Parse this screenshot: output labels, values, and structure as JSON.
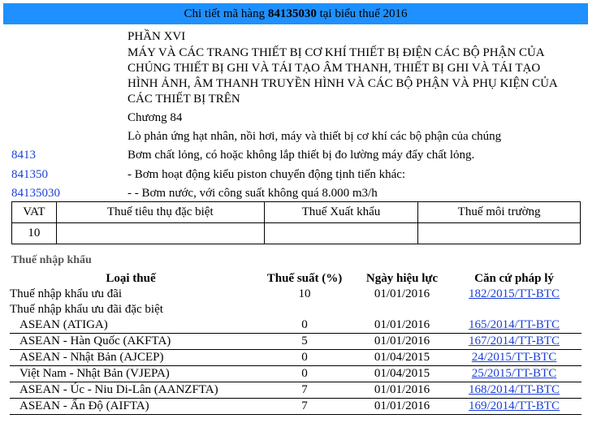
{
  "header": {
    "prefix": "Chi tiết mã hàng",
    "code": "84135030",
    "suffix": "tại biểu thuế 2016"
  },
  "section": {
    "part": "PHẦN XVI",
    "title_lines": [
      "MÁY VÀ CÁC TRANG THIẾT BỊ CƠ KHÍ THIẾT BỊ ĐIỆN CÁC BỘ PHẬN CỦA",
      "CHÚNG THIẾT BỊ GHI VÀ TÁI TẠO ÂM THANH, THIẾT BỊ GHI VÀ TÁI TẠO",
      "HÌNH ẢNH, ÂM THANH TRUYỀN HÌNH VÀ CÁC BỘ PHẬN VÀ PHỤ KIỆN CỦA",
      "CÁC THIẾT BỊ TRÊN"
    ],
    "chapter": "Chương 84",
    "chapter_desc": "Lò phản ứng hạt nhân, nồi hơi, máy và thiết bị cơ khí các bộ phận của chúng"
  },
  "codes": [
    {
      "code": "8413",
      "desc": "Bơm chất lỏng, có hoặc không lắp thiết bị đo lường máy đẩy chất lỏng."
    },
    {
      "code": "841350",
      "desc": "- Bơm hoạt động kiểu piston chuyển động tịnh tiến khác:"
    },
    {
      "code": "84135030",
      "desc": "- - Bơm nước, với công suất không quá 8.000 m3/h"
    }
  ],
  "tax_table": {
    "headers": [
      "VAT",
      "Thuế tiêu thụ đặc biệt",
      "Thuế Xuất khẩu",
      "Thuế môi trường"
    ],
    "values": [
      "10",
      "",
      "",
      ""
    ]
  },
  "import": {
    "title": "Thuế nhập khẩu",
    "headers": [
      "Loại thuế",
      "Thuế suất (%)",
      "Ngày hiệu lực",
      "Căn cứ pháp lý"
    ],
    "rows": [
      {
        "type": "Thuế nhập khẩu ưu đãi",
        "rate": "10",
        "date": "01/01/2016",
        "legal": "182/2015/TT-BTC"
      },
      {
        "type": "Thuế nhập khẩu ưu đãi đặc biệt",
        "rate": "",
        "date": "",
        "legal": ""
      },
      {
        "type": "ASEAN (ATIGA)",
        "rate": "0",
        "date": "01/01/2016",
        "legal": "165/2014/TT-BTC"
      },
      {
        "type": "ASEAN - Hàn Quốc (AKFTA)",
        "rate": "5",
        "date": "01/01/2016",
        "legal": "167/2014/TT-BTC"
      },
      {
        "type": "ASEAN - Nhật Bản (AJCEP)",
        "rate": "0",
        "date": "01/04/2015",
        "legal": "24/2015/TT-BTC"
      },
      {
        "type": "Việt Nam - Nhật Bản (VJEPA)",
        "rate": "0",
        "date": "01/04/2015",
        "legal": "25/2015/TT-BTC"
      },
      {
        "type": "ASEAN - Úc - Niu Di-Lân (AANZFTA)",
        "rate": "7",
        "date": "01/01/2016",
        "legal": "168/2014/TT-BTC"
      },
      {
        "type": "ASEAN - Ấn Độ (AIFTA)",
        "rate": "7",
        "date": "01/01/2016",
        "legal": "169/2014/TT-BTC"
      }
    ]
  }
}
